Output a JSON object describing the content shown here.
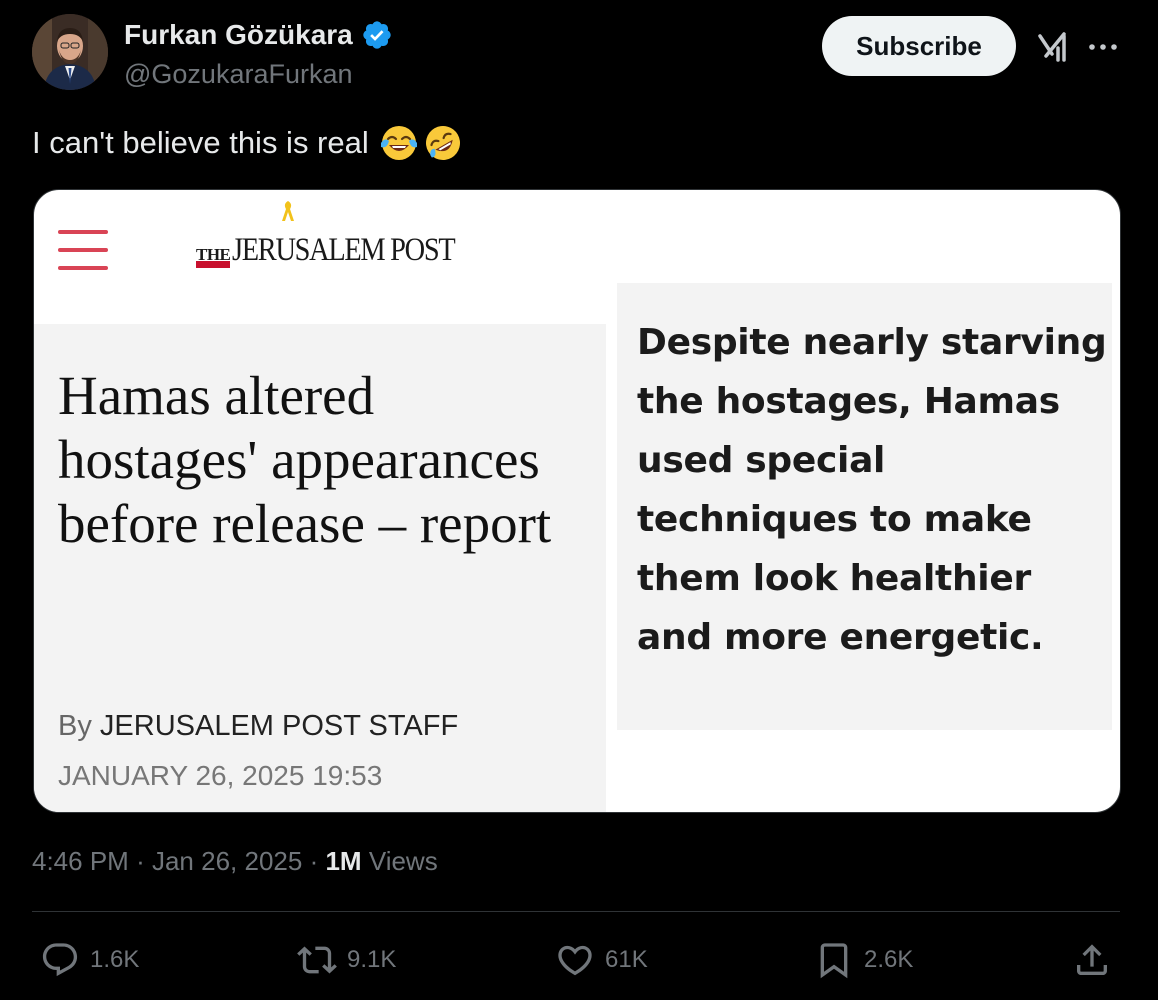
{
  "author": {
    "name": "Furkan Gözükara",
    "handle": "@GozukaraFurkan",
    "verified": true,
    "avatar_icon": "profile-photo"
  },
  "header": {
    "subscribe_label": "Subscribe",
    "grok_icon": "grok-icon",
    "more_icon": "more-dots-icon"
  },
  "tweet": {
    "text": "I can't believe this is real",
    "emojis": [
      "face-with-tears-of-joy",
      "rolling-on-floor-laughing"
    ]
  },
  "media": {
    "logo_the": "THE",
    "logo_name": "JERUSALEM POST",
    "headline": "Hamas altered hostages' appearances before release – report",
    "byline_prefix": "By",
    "byline_author": "JERUSALEM POST STAFF",
    "date": "JANUARY 26, 2025 19:53",
    "quote": "Despite nearly starving the hostages, Hamas used special techniques to make them look healthier and more energetic.",
    "brand_color": "#c8102e"
  },
  "meta": {
    "time": "4:46 PM",
    "date": "Jan 26, 2025",
    "separator": "·",
    "views_count": "1M",
    "views_label": "Views"
  },
  "actions": {
    "replies": "1.6K",
    "reposts": "9.1K",
    "likes": "61K",
    "bookmarks": "2.6K"
  },
  "colors": {
    "background": "#000000",
    "text_primary": "#e7e9ea",
    "text_secondary": "#71767b",
    "verified_blue": "#1d9bf0"
  }
}
